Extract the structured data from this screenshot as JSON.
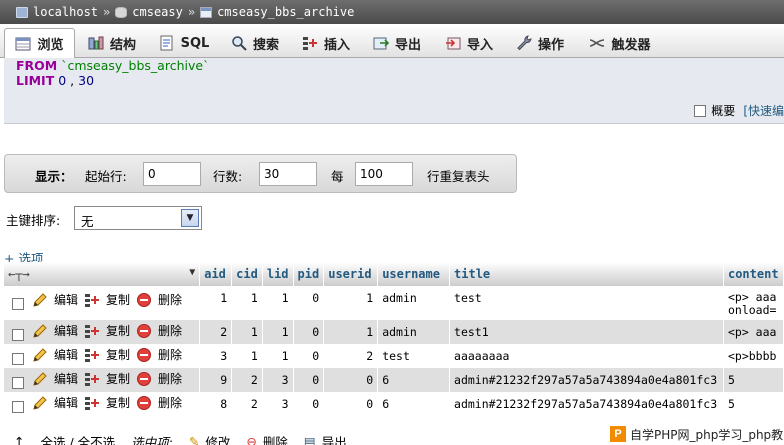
{
  "breadcrumb": {
    "server": "localhost",
    "database": "cmseasy",
    "table": "cmseasy_bbs_archive",
    "separator": "»"
  },
  "tabs": [
    {
      "label": "浏览",
      "icon": "browse-icon",
      "active": true
    },
    {
      "label": "结构",
      "icon": "structure-icon"
    },
    {
      "label": "SQL",
      "icon": "sql-icon"
    },
    {
      "label": "搜索",
      "icon": "search-icon"
    },
    {
      "label": "插入",
      "icon": "insert-icon"
    },
    {
      "label": "导出",
      "icon": "export-icon"
    },
    {
      "label": "导入",
      "icon": "import-icon"
    },
    {
      "label": "操作",
      "icon": "wrench-icon"
    },
    {
      "label": "触发器",
      "icon": "triggers-icon"
    }
  ],
  "sql": {
    "from_kw": "FROM",
    "table": "`cmseasy_bbs_archive`",
    "limit_kw": "LIMIT",
    "limit_start": "0",
    "limit_sep": ",",
    "limit_count": "30",
    "profiling_label": "概要",
    "quick_edit_link": "[快速编"
  },
  "nav": {
    "show_label": "显示：",
    "start_label": "起始行:",
    "start_value": "0",
    "rows_label": "行数:",
    "rows_value": "30",
    "every_label": "每",
    "every_value": "100",
    "repeat_label": "行重复表头"
  },
  "sort": {
    "label": "主键排序:",
    "value": "无"
  },
  "options_link": "+ 选项",
  "table": {
    "columns": [
      "aid",
      "cid",
      "lid",
      "pid",
      "userid",
      "username",
      "title",
      "content"
    ],
    "actions": {
      "edit": "编辑",
      "copy": "复制",
      "delete": "删除"
    },
    "rows": [
      {
        "aid": "1",
        "cid": "1",
        "lid": "1",
        "pid": "0",
        "userid": "1",
        "username": "admin",
        "title": "test",
        "content": "<p> aaa",
        "content2": "onload="
      },
      {
        "aid": "2",
        "cid": "1",
        "lid": "1",
        "pid": "0",
        "userid": "1",
        "username": "admin",
        "title": "test1",
        "content": "<p> aaa",
        "content2": ""
      },
      {
        "aid": "3",
        "cid": "1",
        "lid": "1",
        "pid": "0",
        "userid": "2",
        "username": "test",
        "title": "aaaaaaaa",
        "content": "<p>bbbb",
        "content2": ""
      },
      {
        "aid": "9",
        "cid": "2",
        "lid": "3",
        "pid": "0",
        "userid": "0",
        "username": "6",
        "title": "admin#21232f297a57a5a743894a0e4a801fc3",
        "content": "5",
        "content2": ""
      },
      {
        "aid": "8",
        "cid": "2",
        "lid": "3",
        "pid": "0",
        "userid": "0",
        "username": "6",
        "title": "admin#21232f297a57a5a743894a0e4a801fc3",
        "content": "5",
        "content2": ""
      }
    ]
  },
  "bottom": {
    "check_all": "全选 / 全不选",
    "with_selected": "选中项:",
    "edit": "修改",
    "delete": "删除",
    "export": "导出"
  },
  "watermark": "自学PHP网_php学习_php教"
}
